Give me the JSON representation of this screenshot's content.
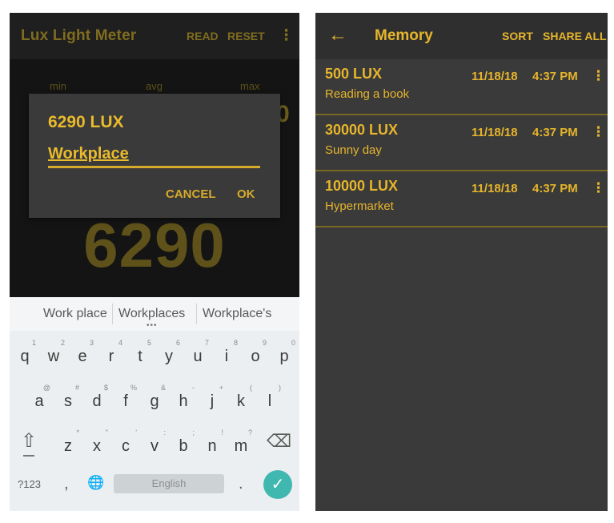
{
  "left": {
    "app_title": "Lux Light Meter",
    "actions": {
      "read": "READ",
      "reset": "RESET",
      "more": "⋮"
    },
    "stats": {
      "min_label": "min",
      "avg_label": "avg",
      "max_label": "max",
      "partial_value": "0"
    },
    "big_value": "6290",
    "dialog": {
      "title": "6290 LUX",
      "input_value": "Workplace",
      "cancel": "CANCEL",
      "ok": "OK"
    },
    "keyboard": {
      "suggestions": [
        "Work place",
        "Workplaces",
        "Workplace's"
      ],
      "more_suggestions": "•••",
      "row1": [
        {
          "ch": "q",
          "hint": "1"
        },
        {
          "ch": "w",
          "hint": "2"
        },
        {
          "ch": "e",
          "hint": "3"
        },
        {
          "ch": "r",
          "hint": "4"
        },
        {
          "ch": "t",
          "hint": "5"
        },
        {
          "ch": "y",
          "hint": "6"
        },
        {
          "ch": "u",
          "hint": "7"
        },
        {
          "ch": "i",
          "hint": "8"
        },
        {
          "ch": "o",
          "hint": "9"
        },
        {
          "ch": "p",
          "hint": "0"
        }
      ],
      "row2": [
        {
          "ch": "a",
          "hint": "@"
        },
        {
          "ch": "s",
          "hint": "#"
        },
        {
          "ch": "d",
          "hint": "$"
        },
        {
          "ch": "f",
          "hint": "%"
        },
        {
          "ch": "g",
          "hint": "&"
        },
        {
          "ch": "h",
          "hint": "-"
        },
        {
          "ch": "j",
          "hint": "+"
        },
        {
          "ch": "k",
          "hint": "("
        },
        {
          "ch": "l",
          "hint": ")"
        }
      ],
      "row3": [
        {
          "ch": "z",
          "hint": "*"
        },
        {
          "ch": "x",
          "hint": "\""
        },
        {
          "ch": "c",
          "hint": "'"
        },
        {
          "ch": "v",
          "hint": ":"
        },
        {
          "ch": "b",
          "hint": ";"
        },
        {
          "ch": "n",
          "hint": "!"
        },
        {
          "ch": "m",
          "hint": "?"
        }
      ],
      "symbols_key": "?123",
      "comma_key": ",",
      "globe_key": "🌐",
      "space_label": "English",
      "period_key": ".",
      "shift_icon": "⇧",
      "backspace_icon": "⌫",
      "enter_icon": "✓"
    }
  },
  "right": {
    "title": "Memory",
    "back_icon": "←",
    "sort": "SORT",
    "share_all": "SHARE ALL",
    "entries": [
      {
        "lux": "500 LUX",
        "note": "Reading a book",
        "date": "11/18/18",
        "time": "4:37 PM",
        "more": "⋮"
      },
      {
        "lux": "30000 LUX",
        "note": "Sunny day",
        "date": "11/18/18",
        "time": "4:37 PM",
        "more": "⋮"
      },
      {
        "lux": "10000 LUX",
        "note": "Hypermarket",
        "date": "11/18/18",
        "time": "4:37 PM",
        "more": "⋮"
      }
    ]
  },
  "colors": {
    "accent": "#e6b52c",
    "dim_accent": "#7f6c1f",
    "dark_bg": "#141414",
    "list_bg": "#3a3a3a",
    "enter_key": "#40b8b0"
  }
}
